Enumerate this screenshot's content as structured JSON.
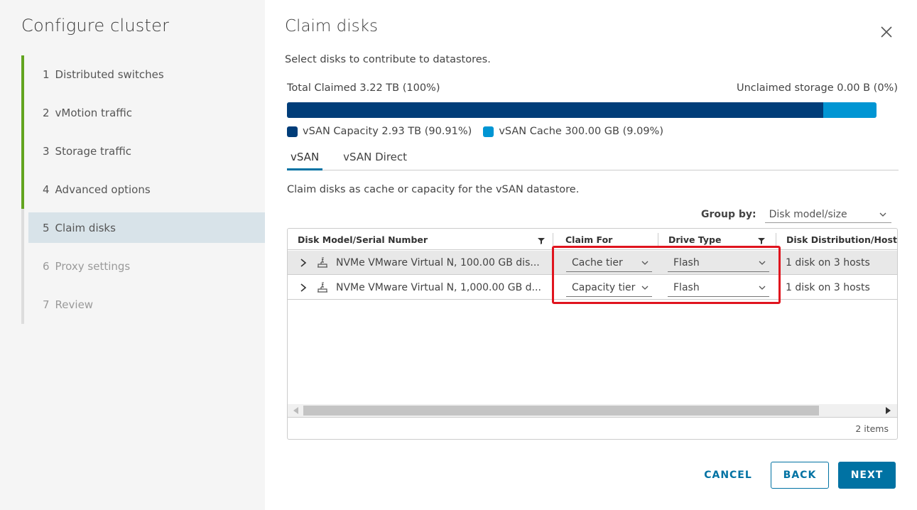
{
  "sidebar": {
    "title": "Configure cluster",
    "steps": [
      {
        "num": "1",
        "label": "Distributed switches"
      },
      {
        "num": "2",
        "label": "vMotion traffic"
      },
      {
        "num": "3",
        "label": "Storage traffic"
      },
      {
        "num": "4",
        "label": "Advanced options"
      },
      {
        "num": "5",
        "label": "Claim disks"
      },
      {
        "num": "6",
        "label": "Proxy settings"
      },
      {
        "num": "7",
        "label": "Review"
      }
    ]
  },
  "main": {
    "title": "Claim disks",
    "subtitle": "Select disks to contribute to datastores.",
    "total_claimed": "Total Claimed 3.22 TB (100%)",
    "unclaimed": "Unclaimed storage 0.00 B (0%)",
    "capacity_fraction": 0.9091,
    "legend": {
      "capacity": "vSAN Capacity 2.93 TB (90.91%)",
      "cache": "vSAN Cache 300.00 GB (9.09%)",
      "capacity_color": "#003d79",
      "cache_color": "#0095d3"
    },
    "tabs": [
      "vSAN",
      "vSAN Direct"
    ],
    "description": "Claim disks as cache or capacity for the vSAN datastore.",
    "group_by": {
      "label": "Group by:",
      "value": "Disk model/size"
    },
    "grid": {
      "columns": [
        "Disk Model/Serial Number",
        "Claim For",
        "Drive Type",
        "Disk Distribution/Host"
      ],
      "rows": [
        {
          "model": "NVMe VMware Virtual N, 100.00 GB dis...",
          "claim_for": "Cache tier",
          "drive_type": "Flash",
          "distribution": "1 disk on 3 hosts"
        },
        {
          "model": "NVMe VMware Virtual N, 1,000.00 GB d...",
          "claim_for": "Capacity tier",
          "drive_type": "Flash",
          "distribution": "1 disk on 3 hosts"
        }
      ],
      "footer": "2 items"
    },
    "buttons": {
      "cancel": "CANCEL",
      "back": "BACK",
      "next": "NEXT"
    },
    "highlight_color": "#e0141e"
  }
}
